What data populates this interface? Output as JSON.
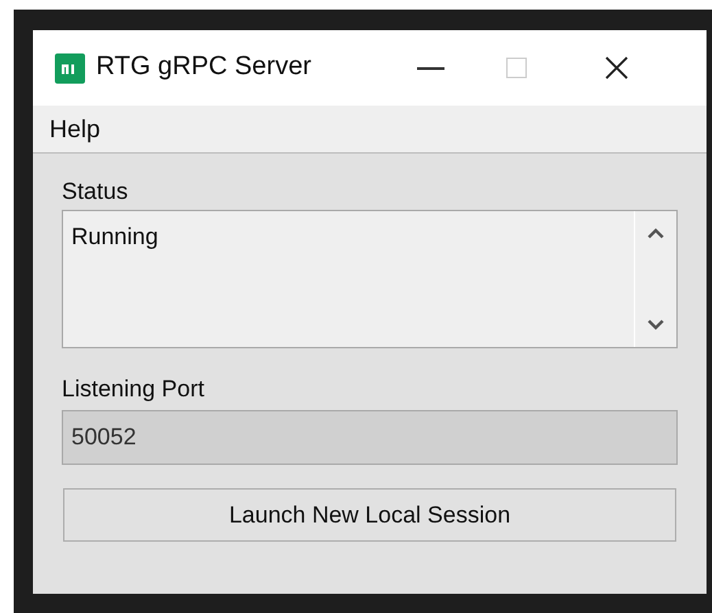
{
  "window": {
    "title": "RTG gRPC Server"
  },
  "menu": [
    {
      "label": "Help"
    }
  ],
  "status": {
    "label": "Status",
    "value": "Running"
  },
  "port": {
    "label": "Listening Port",
    "value": "50052",
    "disabled": true
  },
  "buttons": [
    {
      "label": "Launch New Local Session"
    }
  ]
}
